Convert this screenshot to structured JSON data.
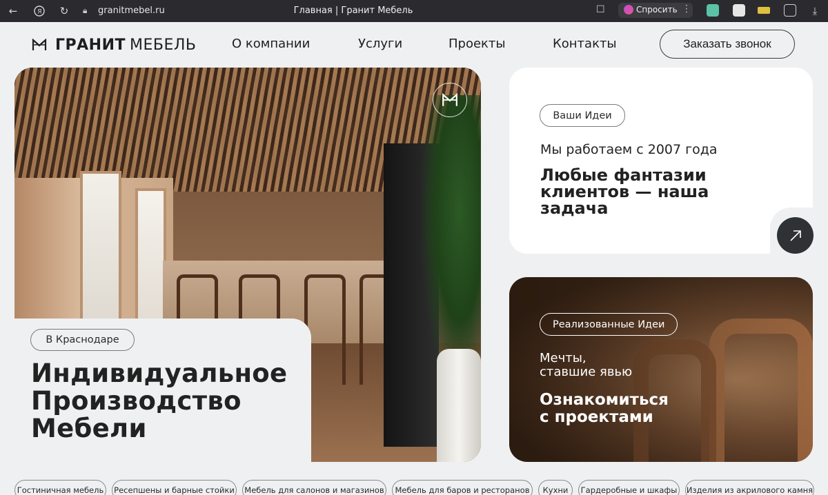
{
  "browser": {
    "url": "granitmebel.ru",
    "tab_title": "Главная | Гранит Мебель",
    "ask_label": "Спросить"
  },
  "header": {
    "logo_word1": "ГРАНИТ",
    "logo_word2": "МЕБЕЛЬ",
    "nav": [
      "О компании",
      "Услуги",
      "Проекты",
      "Контакты"
    ],
    "cta": "Заказать звонок"
  },
  "hero": {
    "location_chip": "В Краснодаре",
    "title_lines": [
      "Индивидуальное",
      "Производство",
      "Мебели"
    ]
  },
  "card_ideas": {
    "chip": "Ваши Идеи",
    "since": "Мы работаем с 2007 года",
    "headline_lines": [
      "Любые фантазии",
      "клиентов — наша",
      "задача"
    ]
  },
  "card_projects": {
    "chip": "Реализованные Идеи",
    "subtitle_lines": [
      "Мечты,",
      "ставшие явью"
    ],
    "link_lines": [
      "Ознакомиться",
      "с проектами"
    ]
  },
  "categories": [
    "Гостиничная мебель",
    "Ресепшены и барные стойки",
    "Мебель для салонов и магазинов",
    "Мебель для баров и ресторанов",
    "Кухни",
    "Гардеробные и шкафы",
    "Изделия из акрилового камня"
  ],
  "colors": {
    "page_bg": "#eff0f2",
    "card_bg": "#ffffff",
    "arrow_button": "#2f3235",
    "text": "#222222"
  }
}
